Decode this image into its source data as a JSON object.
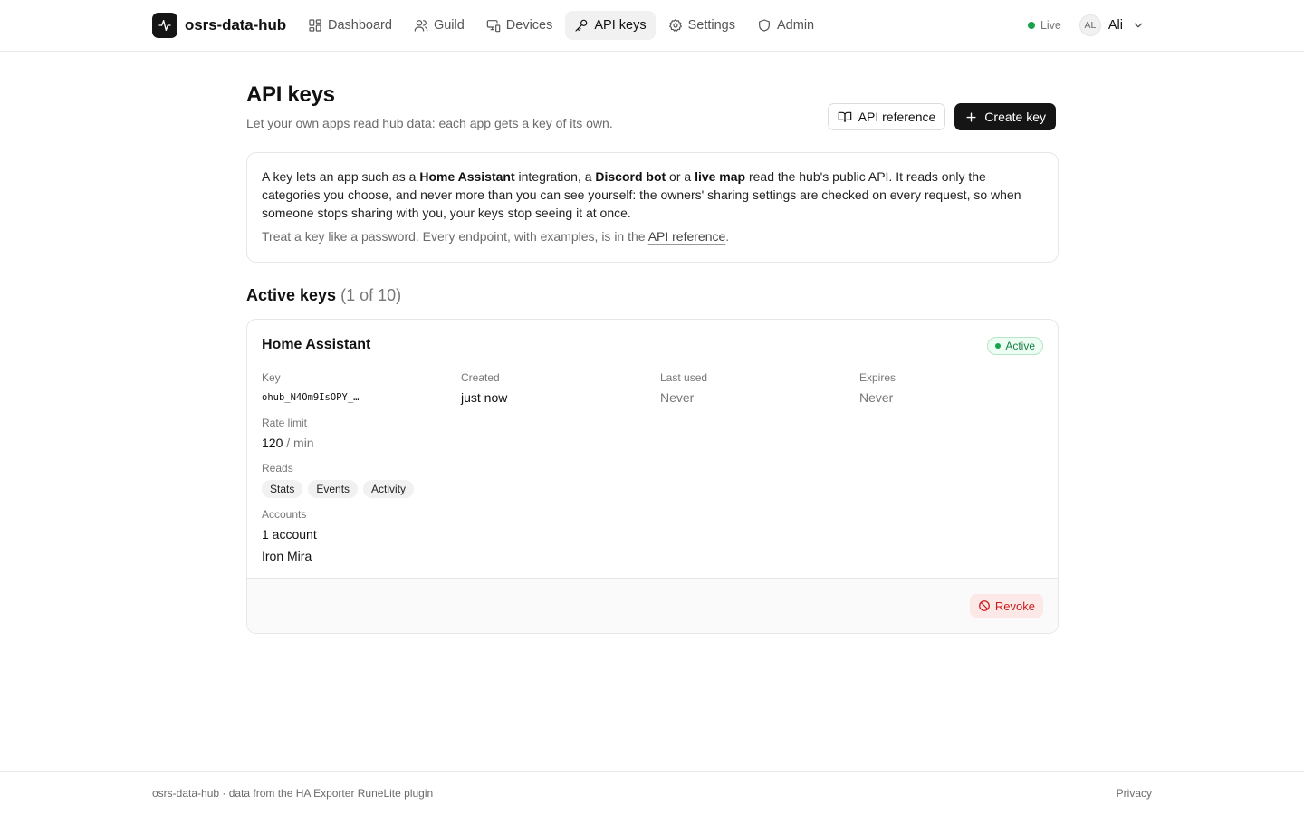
{
  "app": {
    "name": "osrs-data-hub",
    "logo_icon": "activity-pulse-icon"
  },
  "nav": {
    "items": [
      {
        "label": "Dashboard",
        "icon": "dashboard-grid-icon",
        "active": false
      },
      {
        "label": "Guild",
        "icon": "users-icon",
        "active": false
      },
      {
        "label": "Devices",
        "icon": "devices-icon",
        "active": false
      },
      {
        "label": "API keys",
        "icon": "key-icon",
        "active": true
      },
      {
        "label": "Settings",
        "icon": "gear-icon",
        "active": false
      },
      {
        "label": "Admin",
        "icon": "shield-icon",
        "active": false
      }
    ]
  },
  "status": {
    "live_label": "Live",
    "live_color": "#16a34a"
  },
  "user": {
    "initials": "AL",
    "name": "Ali"
  },
  "page": {
    "title": "API keys",
    "subtitle": "Let your own apps read hub data: each app gets a key of its own.",
    "api_reference_button": "API reference",
    "create_key_button": "Create key"
  },
  "info": {
    "p1_a": "A key lets an app such as a ",
    "p1_b": "Home Assistant",
    "p1_c": " integration, a ",
    "p1_d": "Discord bot",
    "p1_e": " or a ",
    "p1_f": "live map",
    "p1_g": " read the hub's public API. It reads only the categories you choose, and never more than you can see yourself: the owners' sharing settings are checked on every request, so when someone stops sharing with you, your keys stop seeing it at once.",
    "p2_a": "Treat a key like a password. Every endpoint, with examples, is in the ",
    "p2_link": "API reference",
    "p2_b": "."
  },
  "active_keys": {
    "title": "Active keys",
    "count": "(1 of 10)",
    "keys": [
      {
        "name": "Home Assistant",
        "status": "Active",
        "key_label": "Key",
        "key_value": "ohub_N4Om9IsOPY_…",
        "created_label": "Created",
        "created_value": "just now",
        "last_used_label": "Last used",
        "last_used_value": "Never",
        "expires_label": "Expires",
        "expires_value": "Never",
        "rate_limit_label": "Rate limit",
        "rate_limit_value": "120",
        "rate_limit_unit": "/ min",
        "reads_label": "Reads",
        "reads": [
          "Stats",
          "Events",
          "Activity"
        ],
        "accounts_label": "Accounts",
        "accounts_count": "1 account",
        "accounts": [
          "Iron Mira"
        ],
        "revoke_label": "Revoke"
      }
    ]
  },
  "footer": {
    "left": "osrs-data-hub · data from the HA Exporter RuneLite plugin",
    "right": "Privacy"
  }
}
